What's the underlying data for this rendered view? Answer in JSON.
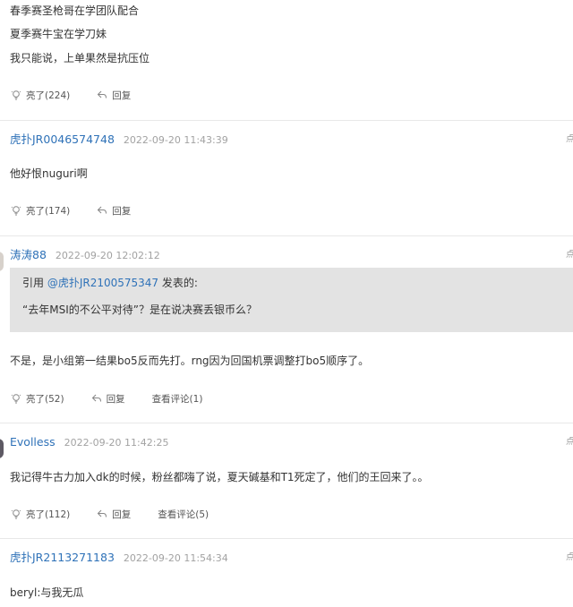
{
  "posts": [
    {
      "lines": [
        "春季赛圣枪哥在学团队配合",
        "夏季赛牛宝在学刀妹",
        "我只能说，上单果然是抗压位"
      ],
      "like_label": "亮了(224)",
      "reply_label": "回复"
    },
    {
      "username": "虎扑JR0046574748",
      "time": "2022-09-20 11:43:39",
      "lines": [
        "他好恨nuguri啊"
      ],
      "like_label": "亮了(174)",
      "reply_label": "回复"
    },
    {
      "username": "涛涛88",
      "time": "2022-09-20 12:02:12",
      "quote": {
        "prefix": "引用 ",
        "user": "@虎扑JR2100575347",
        "suffix": " 发表的:",
        "text": "“去年MSI的不公平对待”？是在说决赛丢银币么？"
      },
      "lines": [
        "不是，是小组第一结果bo5反而先打。rng因为回国机票调整打bo5顺序了。"
      ],
      "like_label": "亮了(52)",
      "reply_label": "回复",
      "comments_label": "查看评论(1)"
    },
    {
      "username": "Evolless",
      "time": "2022-09-20 11:42:25",
      "lines": [
        "我记得牛古力加入dk的时候，粉丝都嗨了说，夏天碱基和T1死定了，他们的王回来了。。"
      ],
      "like_label": "亮了(112)",
      "reply_label": "回复",
      "comments_label": "查看评论(5)"
    },
    {
      "username": "虎扑JR2113271183",
      "time": "2022-09-20 11:54:34",
      "lines": [
        "beryl:与我无瓜"
      ]
    }
  ],
  "edge_glyph": "点",
  "icons": {
    "like": "light-bulb-icon",
    "reply": "reply-arrow-icon"
  },
  "colors": {
    "username": "#2f72b8",
    "timestamp": "#a2a2a2",
    "quote_background": "#e3e3e3",
    "divider": "#e8e8e8"
  }
}
